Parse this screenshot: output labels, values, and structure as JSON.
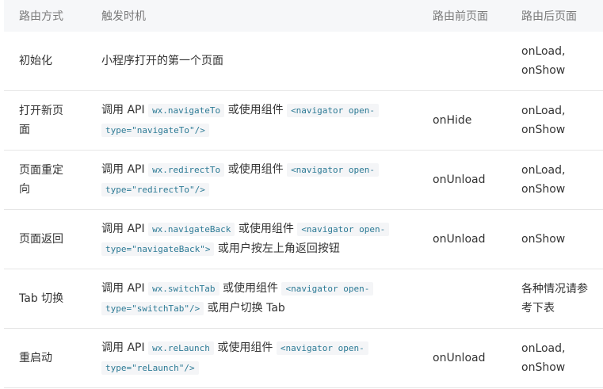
{
  "headers": {
    "method": "路由方式",
    "timing": "触发时机",
    "before": "路由前页面",
    "after": "路由后页面"
  },
  "rows": [
    {
      "method": "初始化",
      "timing_text": "小程序打开的第一个页面",
      "before": "",
      "after_line1": "onLoad,",
      "after_line2": "onShow"
    },
    {
      "method_line1": "打开新页",
      "method_line2": "面",
      "prefix": "调用 API",
      "api": "wx.navigateTo",
      "mid": "或使用组件",
      "comp_line1": "<navigator open-",
      "comp_line2": "type=\"navigateTo\"/>",
      "suffix": "",
      "before": "onHide",
      "after_line1": "onLoad,",
      "after_line2": "onShow"
    },
    {
      "method_line1": "页面重定",
      "method_line2": "向",
      "prefix": "调用 API",
      "api": "wx.redirectTo",
      "mid": "或使用组件",
      "comp_line1": "<navigator open-",
      "comp_line2": "type=\"redirectTo\"/>",
      "suffix": "",
      "before": "onUnload",
      "after_line1": "onLoad,",
      "after_line2": "onShow"
    },
    {
      "method": "页面返回",
      "prefix": "调用 API",
      "api": "wx.navigateBack",
      "mid": "或使用组件",
      "comp_line1": "<navigator open-",
      "comp_line2": "type=\"navigateBack\">",
      "suffix": "或用户按左上角返回按钮",
      "before": "onUnload",
      "after": "onShow"
    },
    {
      "method": "Tab 切换",
      "prefix": "调用 API",
      "api": "wx.switchTab",
      "mid": "或使用组件",
      "comp_line1": "<navigator open-",
      "comp_line2": "type=\"switchTab\"/>",
      "suffix": "或用户切换 Tab",
      "before": "",
      "after_line1": "各种情况请参",
      "after_line2": "考下表"
    },
    {
      "method": "重启动",
      "prefix": "调用 API",
      "api": "wx.reLaunch",
      "mid": "或使用组件",
      "comp_line1": "<navigator open-",
      "comp_line2": "type=\"reLaunch\"/>",
      "suffix": "",
      "before": "onUnload",
      "after_line1": "onLoad,",
      "after_line2": "onShow"
    }
  ]
}
